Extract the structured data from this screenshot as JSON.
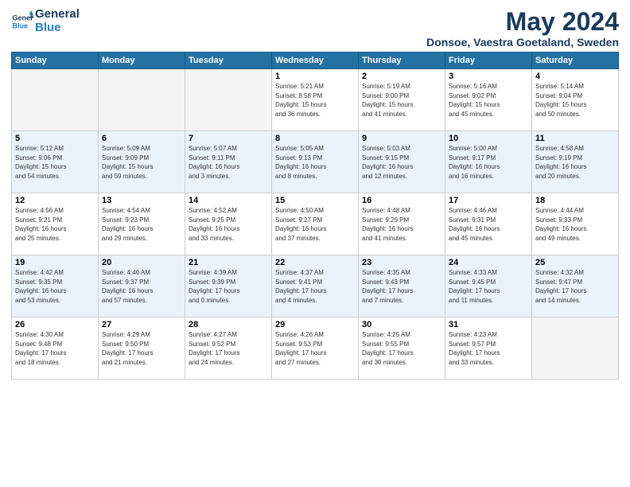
{
  "header": {
    "logo_line1": "General",
    "logo_line2": "Blue",
    "month_year": "May 2024",
    "location": "Donsoe, Vaestra Goetaland, Sweden"
  },
  "weekdays": [
    "Sunday",
    "Monday",
    "Tuesday",
    "Wednesday",
    "Thursday",
    "Friday",
    "Saturday"
  ],
  "weeks": [
    [
      {
        "day": "",
        "info": ""
      },
      {
        "day": "",
        "info": ""
      },
      {
        "day": "",
        "info": ""
      },
      {
        "day": "1",
        "info": "Sunrise: 5:21 AM\nSunset: 8:58 PM\nDaylight: 15 hours\nand 36 minutes."
      },
      {
        "day": "2",
        "info": "Sunrise: 5:19 AM\nSunset: 9:00 PM\nDaylight: 15 hours\nand 41 minutes."
      },
      {
        "day": "3",
        "info": "Sunrise: 5:16 AM\nSunset: 9:02 PM\nDaylight: 15 hours\nand 45 minutes."
      },
      {
        "day": "4",
        "info": "Sunrise: 5:14 AM\nSunset: 9:04 PM\nDaylight: 15 hours\nand 50 minutes."
      }
    ],
    [
      {
        "day": "5",
        "info": "Sunrise: 5:12 AM\nSunset: 9:06 PM\nDaylight: 15 hours\nand 54 minutes."
      },
      {
        "day": "6",
        "info": "Sunrise: 5:09 AM\nSunset: 9:09 PM\nDaylight: 15 hours\nand 59 minutes."
      },
      {
        "day": "7",
        "info": "Sunrise: 5:07 AM\nSunset: 9:11 PM\nDaylight: 16 hours\nand 3 minutes."
      },
      {
        "day": "8",
        "info": "Sunrise: 5:05 AM\nSunset: 9:13 PM\nDaylight: 16 hours\nand 8 minutes."
      },
      {
        "day": "9",
        "info": "Sunrise: 5:03 AM\nSunset: 9:15 PM\nDaylight: 16 hours\nand 12 minutes."
      },
      {
        "day": "10",
        "info": "Sunrise: 5:00 AM\nSunset: 9:17 PM\nDaylight: 16 hours\nand 16 minutes."
      },
      {
        "day": "11",
        "info": "Sunrise: 4:58 AM\nSunset: 9:19 PM\nDaylight: 16 hours\nand 20 minutes."
      }
    ],
    [
      {
        "day": "12",
        "info": "Sunrise: 4:56 AM\nSunset: 9:21 PM\nDaylight: 16 hours\nand 25 minutes."
      },
      {
        "day": "13",
        "info": "Sunrise: 4:54 AM\nSunset: 9:23 PM\nDaylight: 16 hours\nand 29 minutes."
      },
      {
        "day": "14",
        "info": "Sunrise: 4:52 AM\nSunset: 9:25 PM\nDaylight: 16 hours\nand 33 minutes."
      },
      {
        "day": "15",
        "info": "Sunrise: 4:50 AM\nSunset: 9:27 PM\nDaylight: 16 hours\nand 37 minutes."
      },
      {
        "day": "16",
        "info": "Sunrise: 4:48 AM\nSunset: 9:29 PM\nDaylight: 16 hours\nand 41 minutes."
      },
      {
        "day": "17",
        "info": "Sunrise: 4:46 AM\nSunset: 9:31 PM\nDaylight: 16 hours\nand 45 minutes."
      },
      {
        "day": "18",
        "info": "Sunrise: 4:44 AM\nSunset: 9:33 PM\nDaylight: 16 hours\nand 49 minutes."
      }
    ],
    [
      {
        "day": "19",
        "info": "Sunrise: 4:42 AM\nSunset: 9:35 PM\nDaylight: 16 hours\nand 53 minutes."
      },
      {
        "day": "20",
        "info": "Sunrise: 4:40 AM\nSunset: 9:37 PM\nDaylight: 16 hours\nand 57 minutes."
      },
      {
        "day": "21",
        "info": "Sunrise: 4:39 AM\nSunset: 9:39 PM\nDaylight: 17 hours\nand 0 minutes."
      },
      {
        "day": "22",
        "info": "Sunrise: 4:37 AM\nSunset: 9:41 PM\nDaylight: 17 hours\nand 4 minutes."
      },
      {
        "day": "23",
        "info": "Sunrise: 4:35 AM\nSunset: 9:43 PM\nDaylight: 17 hours\nand 7 minutes."
      },
      {
        "day": "24",
        "info": "Sunrise: 4:33 AM\nSunset: 9:45 PM\nDaylight: 17 hours\nand 11 minutes."
      },
      {
        "day": "25",
        "info": "Sunrise: 4:32 AM\nSunset: 9:47 PM\nDaylight: 17 hours\nand 14 minutes."
      }
    ],
    [
      {
        "day": "26",
        "info": "Sunrise: 4:30 AM\nSunset: 9:48 PM\nDaylight: 17 hours\nand 18 minutes."
      },
      {
        "day": "27",
        "info": "Sunrise: 4:29 AM\nSunset: 9:50 PM\nDaylight: 17 hours\nand 21 minutes."
      },
      {
        "day": "28",
        "info": "Sunrise: 4:27 AM\nSunset: 9:52 PM\nDaylight: 17 hours\nand 24 minutes."
      },
      {
        "day": "29",
        "info": "Sunrise: 4:26 AM\nSunset: 9:53 PM\nDaylight: 17 hours\nand 27 minutes."
      },
      {
        "day": "30",
        "info": "Sunrise: 4:25 AM\nSunset: 9:55 PM\nDaylight: 17 hours\nand 30 minutes."
      },
      {
        "day": "31",
        "info": "Sunrise: 4:23 AM\nSunset: 9:57 PM\nDaylight: 17 hours\nand 33 minutes."
      },
      {
        "day": "",
        "info": ""
      }
    ]
  ]
}
